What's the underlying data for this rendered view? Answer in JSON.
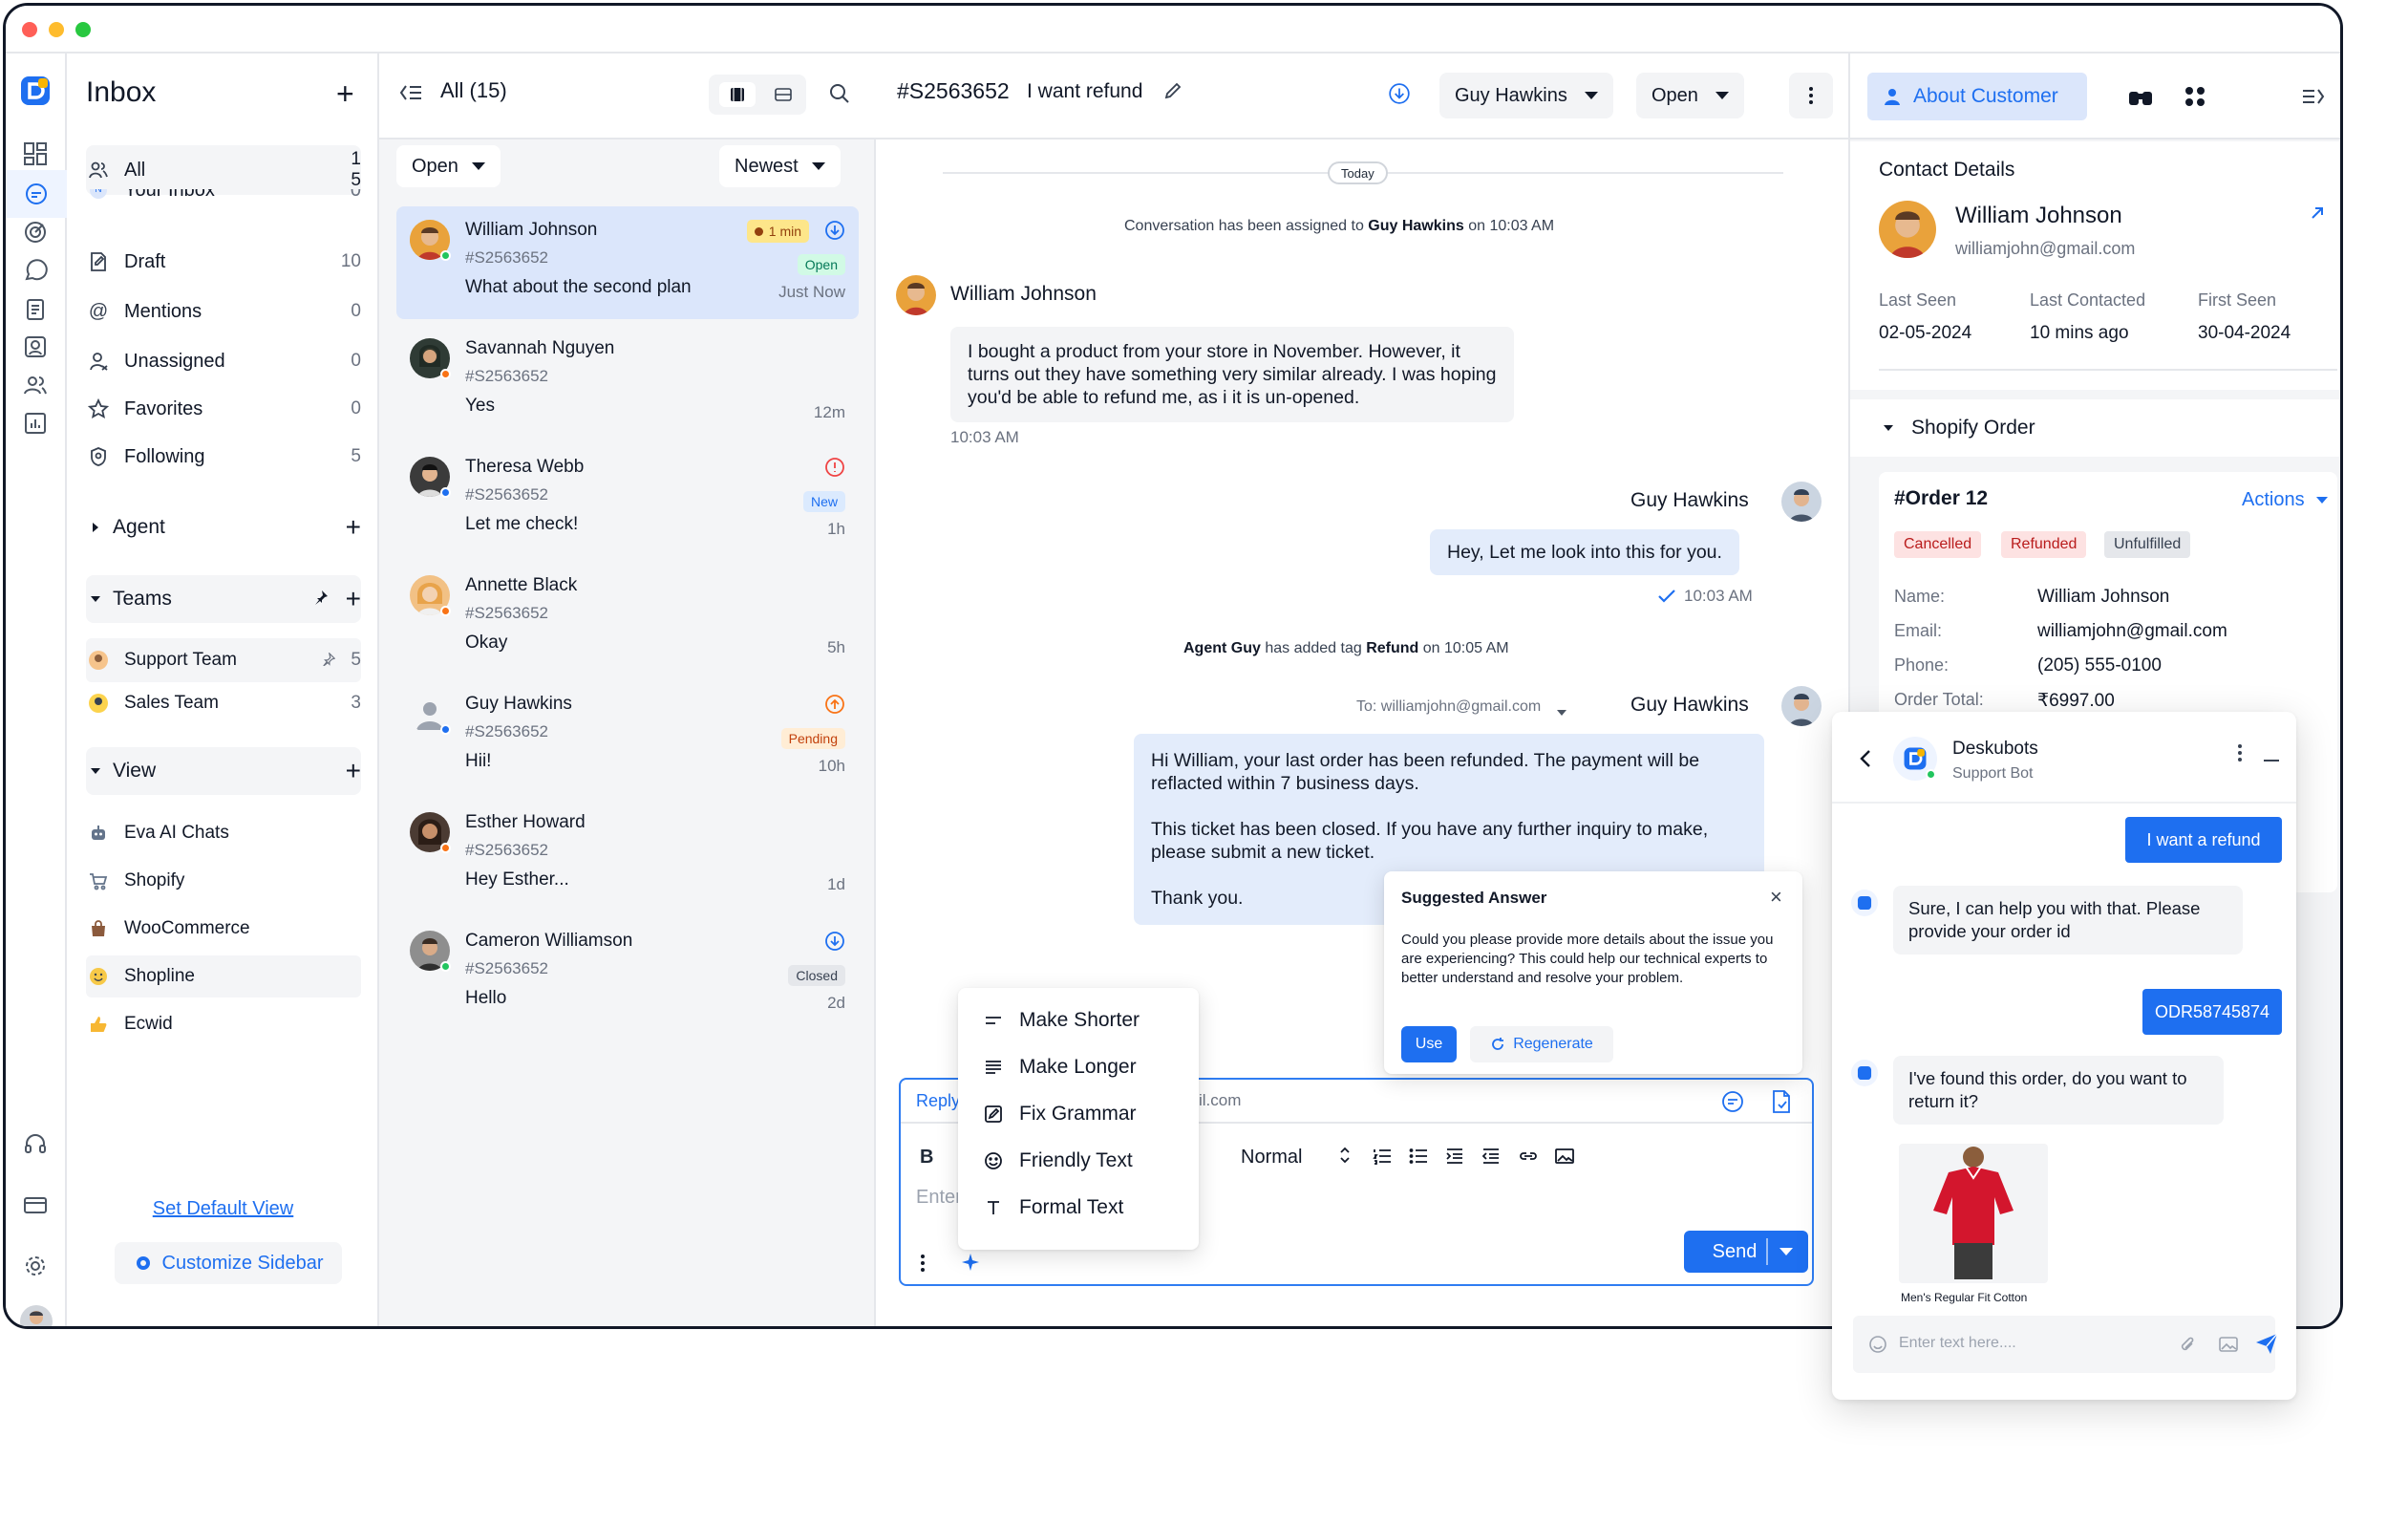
{
  "sidebar": {
    "title": "Inbox",
    "items": [
      {
        "label": "All",
        "count": "1\n5"
      },
      {
        "label": "Your Inbox",
        "count": "0"
      },
      {
        "label": "Draft",
        "count": "10"
      },
      {
        "label": "Mentions",
        "count": "0"
      },
      {
        "label": "Unassigned",
        "count": "0"
      },
      {
        "label": "Favorites",
        "count": "0"
      },
      {
        "label": "Following",
        "count": "5"
      }
    ],
    "agent_label": "Agent",
    "teams_label": "Teams",
    "teams": [
      {
        "label": "Support Team",
        "count": "5"
      },
      {
        "label": "Sales Team",
        "count": "3"
      }
    ],
    "view_label": "View",
    "views": [
      "Eva AI Chats",
      "Shopify",
      "WooCommerce",
      "Shopline",
      "Ecwid"
    ],
    "set_default_view": "Set Default View",
    "customize_sidebar": "Customize Sidebar"
  },
  "convlist": {
    "title": "All (15)",
    "status_filter": "Open",
    "sort": "Newest",
    "items": [
      {
        "name": "William Johnson",
        "id": "#S2563652",
        "message": "What about the second plan",
        "time": "Just Now",
        "badge": "Open",
        "sla": "1 min"
      },
      {
        "name": "Savannah Nguyen",
        "id": "#S2563652",
        "message": "Yes",
        "time": "12m",
        "badge": ""
      },
      {
        "name": "Theresa Webb",
        "id": "#S2563652",
        "message": "Let me check!",
        "time": "1h",
        "badge": "New"
      },
      {
        "name": "Annette Black",
        "id": "#S2563652",
        "message": "Okay",
        "time": "5h",
        "badge": ""
      },
      {
        "name": "Guy Hawkins",
        "id": "#S2563652",
        "message": "Hii!",
        "time": "10h",
        "badge": "Pending"
      },
      {
        "name": "Esther Howard",
        "id": "#S2563652",
        "message": "Hey Esther...",
        "time": "1d",
        "badge": ""
      },
      {
        "name": "Cameron Williamson",
        "id": "#S2563652",
        "message": "Hello",
        "time": "2d",
        "badge": "Closed"
      }
    ]
  },
  "chat": {
    "ticket_id": "#S2563652",
    "subject": "I want refund",
    "assignee": "Guy Hawkins",
    "status": "Open",
    "date_sep": "Today",
    "sys1_pre": "Conversation has been assigned to ",
    "sys1_name": "Guy Hawkins",
    "sys1_mid": " on 10:03  AM",
    "customer_name": "William Johnson",
    "customer_msg": "I bought a product from your store in November. However, it turns out they have something very similar already. I was hoping you'd be able to refund me, as i it is un-opened.",
    "customer_time": "10:03 AM",
    "agent_name": "Guy Hawkins",
    "agent_msg": "Hey, Let me look into this for you.",
    "agent_time": "10:03 AM",
    "sys2_a": "Agent Guy",
    "sys2_b": " has added tag ",
    "sys2_c": "Refund",
    "sys2_d": " on 10:05 AM",
    "email_to": "To: williamjohn@gmail.com",
    "email_p1": "Hi William, your last order has been refunded. The payment will be reflacted within 7 business days.",
    "email_p2": "This ticket has been closed. If you have any further inquiry to make, please submit a new ticket.",
    "email_p3": "Thank you.",
    "suggest_title": "Suggested Answer",
    "suggest_text": "Could you please provide more details about the issue you are experiencing? This could help our technical experts to better understand and resolve your problem.",
    "use_label": "Use",
    "regen_label": "Regenerate",
    "ai_menu": [
      "Make Shorter",
      "Make Longer",
      "Fix Grammar",
      "Friendly Text",
      "Formal Text"
    ],
    "reply_label": "Reply",
    "reply_to_tail": "il.com",
    "bold_label": "B",
    "font_size": "Normal",
    "input_placeholder": "Enter",
    "send_label": "Send"
  },
  "details": {
    "about_label": "About Customer",
    "contact_title": "Contact Details",
    "customer_name": "William Johnson",
    "customer_email": "williamjohn@gmail.com",
    "last_seen_label": "Last Seen",
    "last_seen": "02-05-2024",
    "last_contacted_label": "Last Contacted",
    "last_contacted": "10 mins ago",
    "first_seen_label": "First Seen",
    "first_seen": "30-04-2024",
    "shopify_label": "Shopify Order",
    "order_id": "#Order 12",
    "actions_label": "Actions",
    "tags": [
      "Cancelled",
      "Refunded",
      "Unfulfilled"
    ],
    "name_label": "Name:",
    "name": "William Johnson",
    "email_label": "Email:",
    "email": "williamjohn@gmail.com",
    "phone_label": "Phone:",
    "phone": "(205) 555-0100",
    "total_label": "Order Total:",
    "total": "₹6997.00"
  },
  "bot": {
    "name": "Deskubots",
    "subtitle": "Support Bot",
    "msg_user1": "I want a refund",
    "msg_bot1": "Sure, I can help you with that. Please provide your order id",
    "msg_user2": "ODR58745874",
    "msg_bot2": "I've found this order, do you want to return it?",
    "product_caption": "Men's Regular Fit Cotton",
    "input_placeholder": "Enter text here....",
    "colors": {
      "accent": "#1e6ff0",
      "product": "#d3162d"
    }
  },
  "colors": {
    "accent": "#1e6ff0",
    "selected": "#dbe6fb",
    "panel": "#f4f5f7"
  }
}
